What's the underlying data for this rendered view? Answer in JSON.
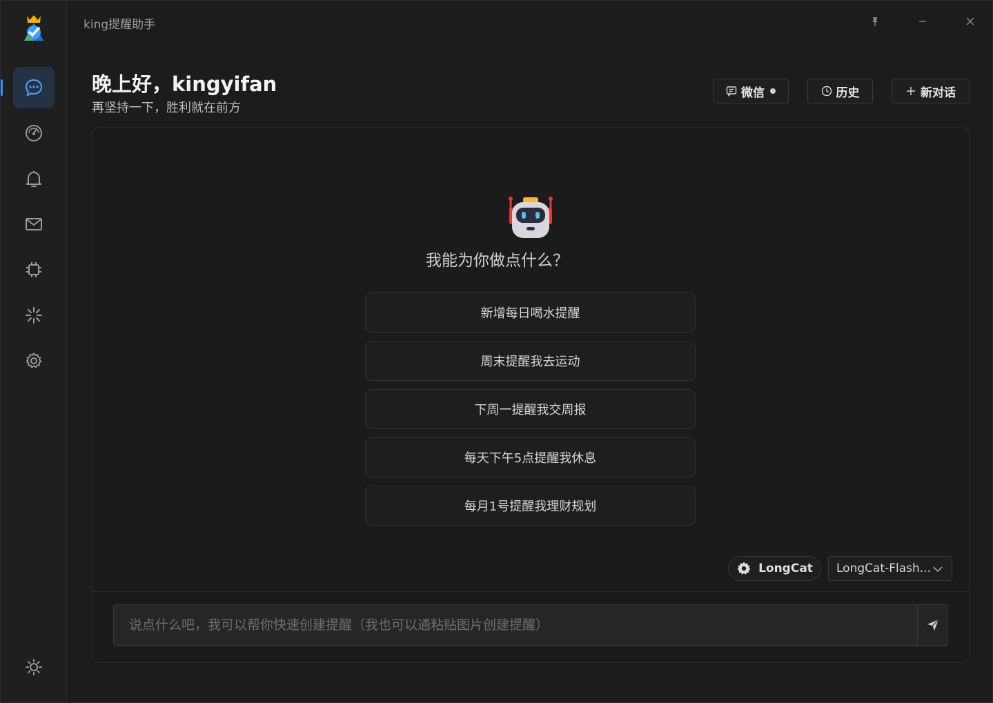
{
  "app": {
    "title": "king提醒助手"
  },
  "header": {
    "greeting": "晚上好，kingyifan",
    "subtitle": "再坚持一下，胜利就在前方",
    "wechat_label": "微信",
    "history_label": "历史",
    "new_chat_label": "新对话"
  },
  "sidebar": {
    "items": [
      {
        "icon": "chat-icon",
        "active": true
      },
      {
        "icon": "gauge-icon"
      },
      {
        "icon": "bell-icon"
      },
      {
        "icon": "mail-icon"
      },
      {
        "icon": "chip-icon"
      },
      {
        "icon": "sparkle-icon"
      },
      {
        "icon": "settings-icon"
      }
    ],
    "theme_icon": "sun-icon"
  },
  "main": {
    "prompt": "我能为你做点什么？",
    "suggestions": [
      "新增每日喝水提醒",
      "周末提醒我去运动",
      "下周一提醒我交周报",
      "每天下午5点提醒我休息",
      "每月1号提醒我理财规划"
    ],
    "provider": "LongCat",
    "model": "LongCat-Flash..."
  },
  "input": {
    "placeholder": "说点什么吧，我可以帮你快速创建提醒（我也可以通粘贴图片创建提醒）"
  },
  "colors": {
    "accent": "#3d8bfd",
    "active_nav_bg": "#243244",
    "background": "#1c1c1c"
  }
}
